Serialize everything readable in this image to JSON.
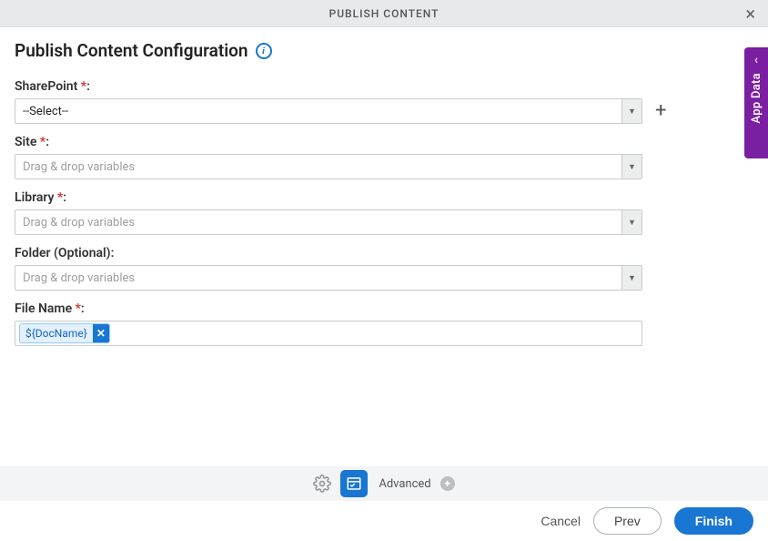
{
  "header": {
    "title": "PUBLISH CONTENT"
  },
  "page": {
    "title": "Publish Content Configuration"
  },
  "fields": {
    "sharepoint": {
      "label": "SharePoint",
      "required": true,
      "value": "--Select--"
    },
    "site": {
      "label": "Site",
      "required": true,
      "placeholder": "Drag & drop variables"
    },
    "library": {
      "label": "Library",
      "required": true,
      "placeholder": "Drag & drop variables"
    },
    "folder": {
      "label": "Folder (Optional):",
      "required": false,
      "placeholder": "Drag & drop variables"
    },
    "filename": {
      "label": "File Name",
      "required": true,
      "chip": "${DocName}"
    }
  },
  "footer": {
    "advanced": "Advanced"
  },
  "actions": {
    "cancel": "Cancel",
    "prev": "Prev",
    "finish": "Finish"
  },
  "sidetab": {
    "label": "App Data"
  }
}
